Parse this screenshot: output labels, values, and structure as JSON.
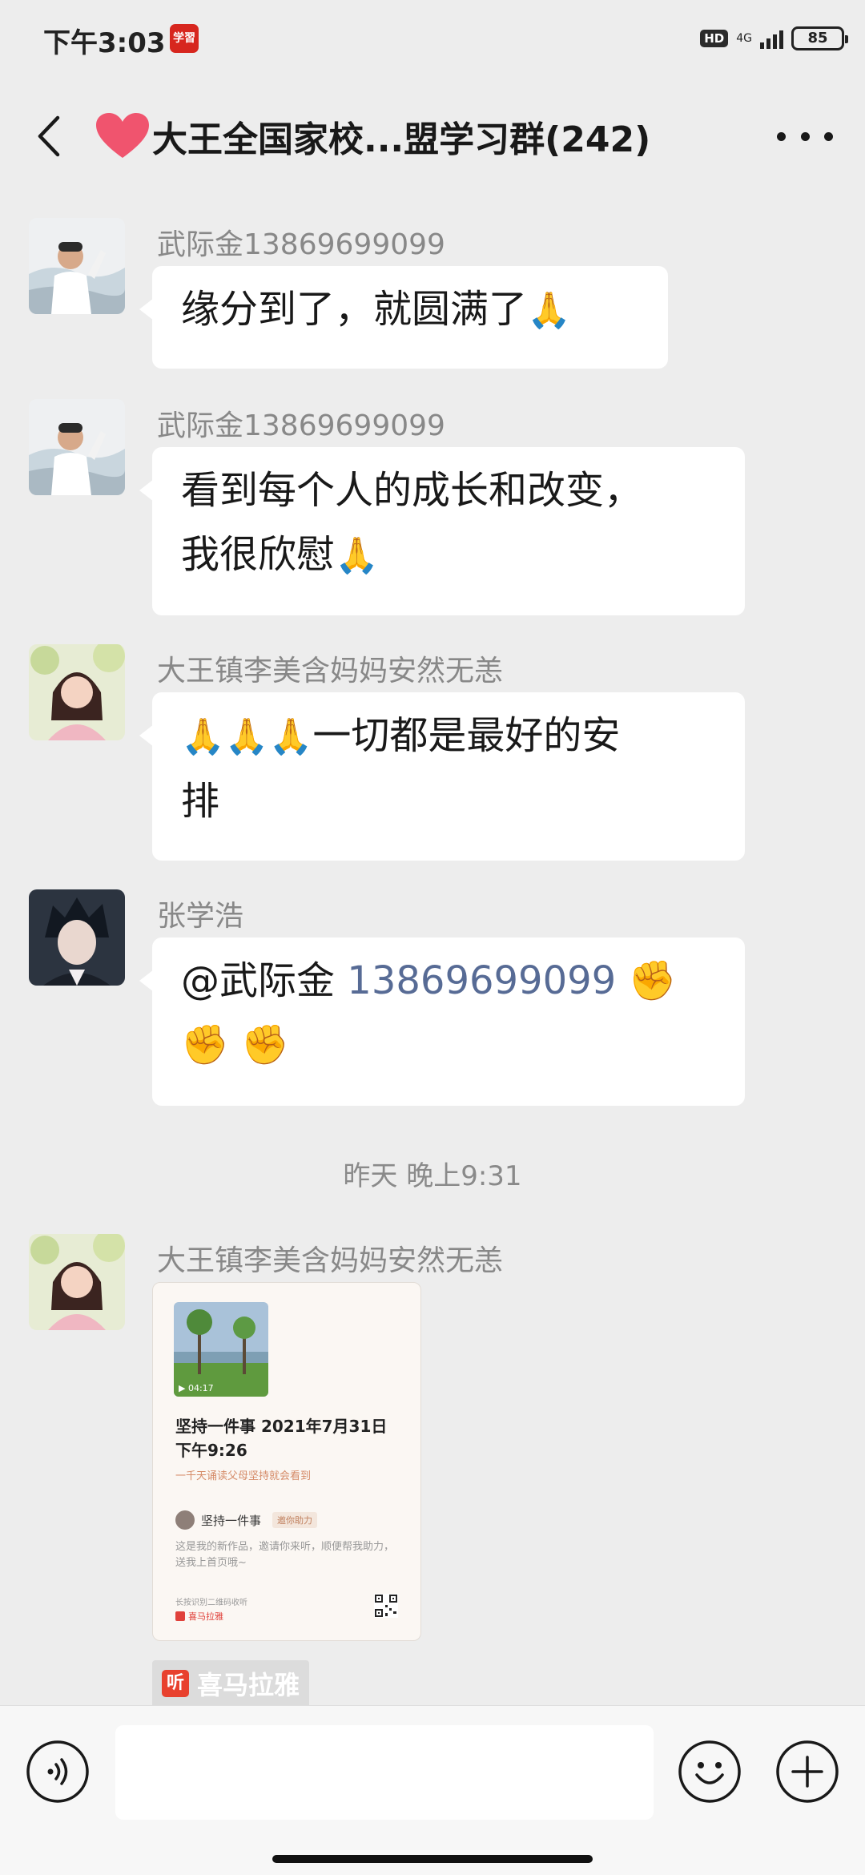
{
  "status_bar": {
    "time": "下午3:03",
    "app_icon_text": "学習",
    "hd_label": "HD",
    "network_label": "4G",
    "battery": "85"
  },
  "header": {
    "title": "大王全国家校...盟学习群(242)",
    "heart_color": "#f0546e"
  },
  "messages": [
    {
      "sender": "武际金13869699099",
      "text": "缘分到了，就圆满了",
      "emoji": "🙏"
    },
    {
      "sender": "武际金13869699099",
      "line1": "看到每个人的成长和改变，",
      "line2": "我很欣慰",
      "emoji": "🙏"
    },
    {
      "sender": "大王镇李美含妈妈安然无恙",
      "emoji_prefix": "🙏🙏🙏",
      "line1": "一切都是最好的安",
      "line2": "排"
    },
    {
      "sender": "张学浩",
      "mention_name": "@武际金",
      "mention_number": "13869699099",
      "emoji_tail": "✊",
      "line2": "✊ ✊"
    }
  ],
  "timestamp": "昨天 晚上9:31",
  "share_message": {
    "sender": "大王镇李美含妈妈安然无恙",
    "card": {
      "duration": "▶ 04:17",
      "title": "坚持一件事 2021年7月31日 下午9:26",
      "subtitle": "一千天诵读父母坚持就会看到",
      "user_name": "坚持一件事",
      "badge": "邀你助力",
      "description": "这是我的新作品，邀请你来听，顺便帮我助力，送我上首页哦~",
      "hint": "长按识别二维码收听",
      "brand": "喜马拉雅"
    },
    "source_icon": "听",
    "source_name": "喜马拉雅"
  },
  "input_bar": {
    "placeholder": ""
  }
}
